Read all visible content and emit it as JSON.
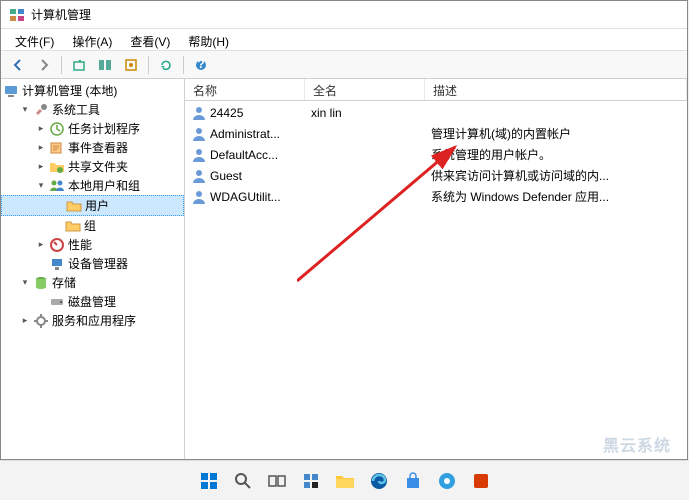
{
  "window": {
    "title": "计算机管理"
  },
  "menu": {
    "file": "文件(F)",
    "action": "操作(A)",
    "view": "查看(V)",
    "help": "帮助(H)"
  },
  "tree": {
    "root": "计算机管理 (本地)",
    "system_tools": "系统工具",
    "task_scheduler": "任务计划程序",
    "event_viewer": "事件查看器",
    "shared_folders": "共享文件夹",
    "local_users_groups": "本地用户和组",
    "users": "用户",
    "groups": "组",
    "performance": "性能",
    "device_manager": "设备管理器",
    "storage": "存储",
    "disk_management": "磁盘管理",
    "services_apps": "服务和应用程序"
  },
  "list": {
    "headers": {
      "name": "名称",
      "fullname": "全名",
      "description": "描述"
    },
    "rows": [
      {
        "name": "24425",
        "fullname": "xin lin",
        "description": ""
      },
      {
        "name": "Administrat...",
        "fullname": "",
        "description": "管理计算机(域)的内置帐户"
      },
      {
        "name": "DefaultAcc...",
        "fullname": "",
        "description": "系统管理的用户帐户。"
      },
      {
        "name": "Guest",
        "fullname": "",
        "description": "供来宾访问计算机或访问域的内..."
      },
      {
        "name": "WDAGUtilit...",
        "fullname": "",
        "description": "系统为 Windows Defender 应用..."
      }
    ]
  },
  "watermark": "黑云系统"
}
